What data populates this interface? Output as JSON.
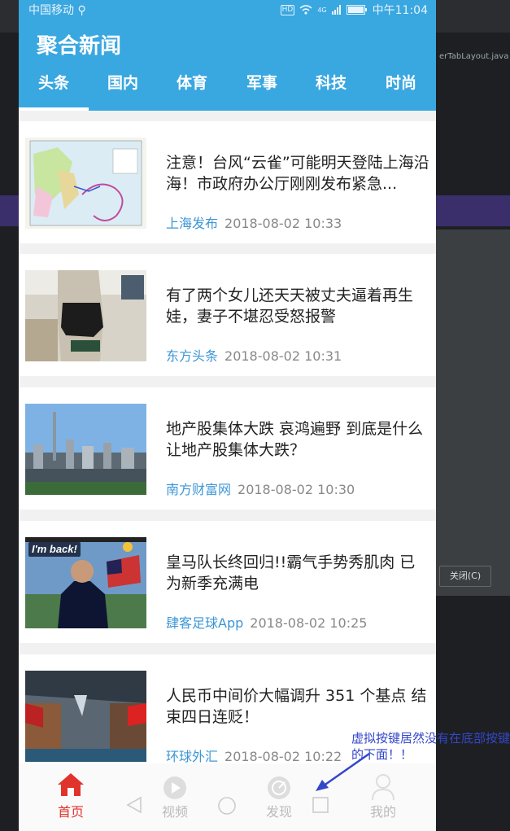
{
  "ide": {
    "close_label": "关闭(C)",
    "tab_text": "erTabLayout.java"
  },
  "status_bar": {
    "carrier": "中国移动 ⚲",
    "hd": "HD",
    "signal": "4G",
    "time": "中午11:04"
  },
  "app": {
    "title": "聚合新闻"
  },
  "tabs": [
    {
      "label": "头条",
      "active": true
    },
    {
      "label": "国内"
    },
    {
      "label": "体育"
    },
    {
      "label": "军事"
    },
    {
      "label": "科技"
    },
    {
      "label": "时尚"
    }
  ],
  "news": [
    {
      "title": "注意！台风“云雀”可能明天登陆上海沿海！市政府办公厅刚刚发布紧急...",
      "source": "上海发布",
      "time": "2018-08-02 10:33"
    },
    {
      "title": "有了两个女儿还天天被丈夫逼着再生娃，妻子不堪忍受怒报警",
      "source": "东方头条",
      "time": "2018-08-02 10:31"
    },
    {
      "title": "地产股集体大跌 哀鸿遍野 到底是什么让地产股集体大跌？",
      "source": "南方财富网",
      "time": "2018-08-02 10:30"
    },
    {
      "title": "皇马队长终回归!!霸气手势秀肌肉 已为新季充满电",
      "source": "肆客足球App",
      "time": "2018-08-02 10:25",
      "thumb_text": "I'm back!"
    },
    {
      "title": "人民币中间价大幅调升 351 个基点 结束四日连贬！",
      "source": "环球外汇",
      "time": "2018-08-02 10:22"
    }
  ],
  "bottom_nav": [
    {
      "label": "首页",
      "icon": "home-icon",
      "active": true
    },
    {
      "label": "视频",
      "icon": "video-icon"
    },
    {
      "label": "发现",
      "icon": "discover-icon"
    },
    {
      "label": "我的",
      "icon": "profile-icon"
    }
  ],
  "annotation": "虚拟按键居然没有在底部按键的下面！！",
  "colors": {
    "primary": "#39a7e0",
    "active_nav": "#e0332c",
    "source": "#3b96d6",
    "annotation": "#3347c9"
  }
}
